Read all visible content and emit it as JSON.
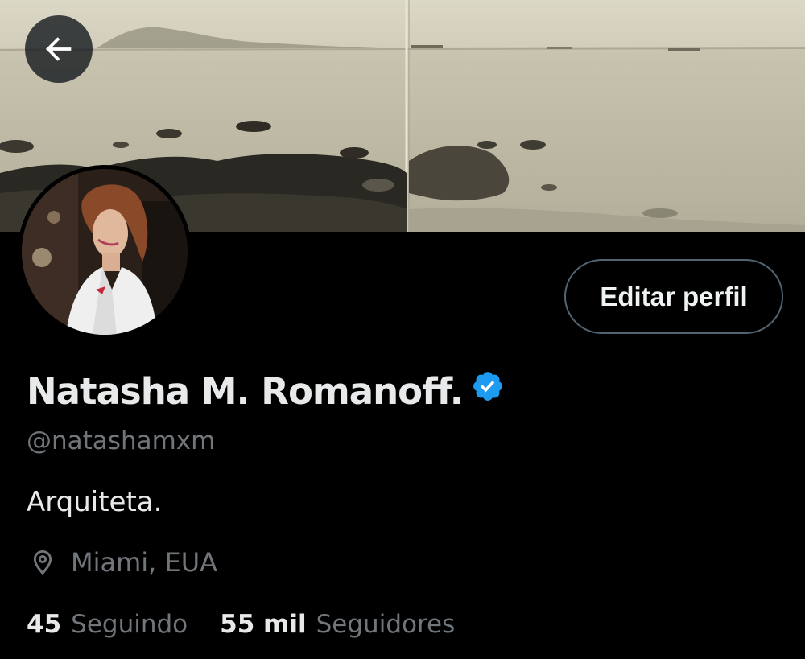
{
  "profile": {
    "display_name": "Natasha M. Romanoff.",
    "handle": "@natashamxm",
    "bio": "Arquiteta.",
    "location": "Miami, EUA",
    "verified": true
  },
  "actions": {
    "edit_profile_label": "Editar perfil"
  },
  "stats": {
    "following_count": "45",
    "following_label": "Seguindo",
    "followers_count": "55 mil",
    "followers_label": "Seguidores"
  },
  "icons": {
    "back": "arrow-left-icon",
    "verified": "verified-badge-icon",
    "location": "location-pin-icon"
  },
  "colors": {
    "background": "#000000",
    "primary_text": "#e7e9ea",
    "secondary_text": "#71767b",
    "verified_blue": "#1d9bf0",
    "button_border": "#536471"
  }
}
